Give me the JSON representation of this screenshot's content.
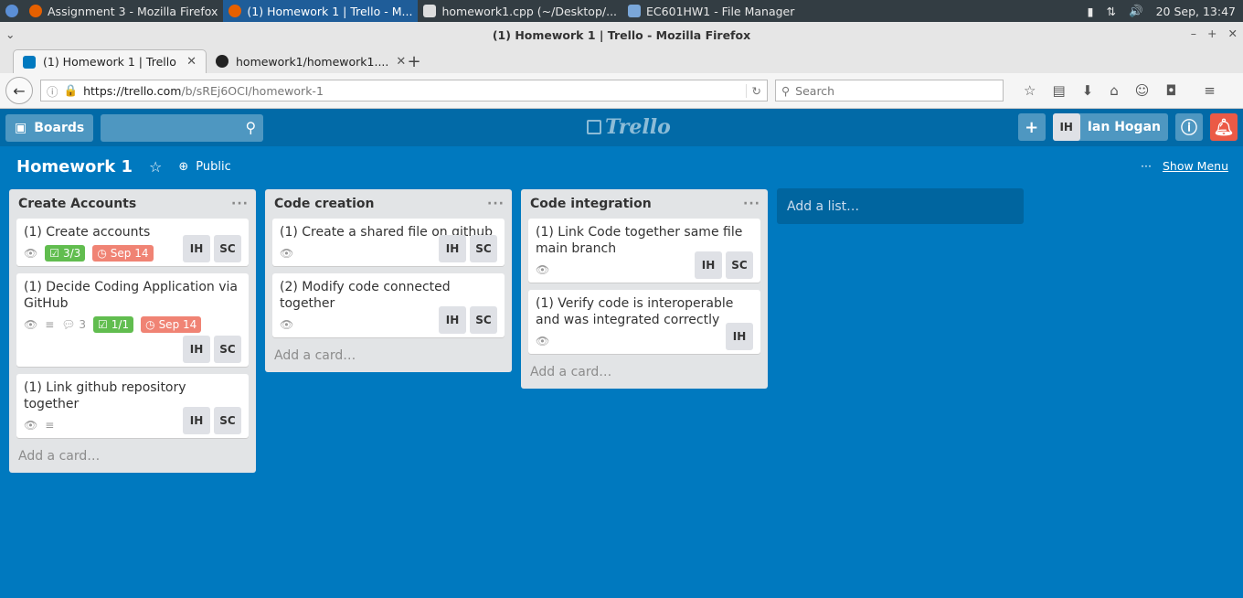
{
  "taskbar": {
    "items": [
      {
        "label": "Assignment 3 - Mozilla Firefox"
      },
      {
        "label": "(1) Homework 1 | Trello - M..."
      },
      {
        "label": "homework1.cpp (~/Desktop/..."
      },
      {
        "label": "EC601HW1 - File Manager"
      }
    ],
    "clock": "20 Sep, 13:47"
  },
  "firefox": {
    "window_title": "(1) Homework 1 | Trello - Mozilla Firefox",
    "tabs": [
      {
        "label": "(1) Homework 1 | Trello"
      },
      {
        "label": "homework1/homework1...."
      }
    ],
    "url_domain": "https://trello.com",
    "url_path": "/b/sREj6OCI/homework-1",
    "search_placeholder": "Search"
  },
  "trello": {
    "boards_label": "Boards",
    "logo": "Trello",
    "user_initials": "IH",
    "user_name": "Ian Hogan",
    "board_title": "Homework 1",
    "visibility": "Public",
    "show_menu": "Show Menu",
    "add_list": "Add a list…",
    "add_card": "Add a card…"
  },
  "lists": [
    {
      "title": "Create Accounts",
      "cards": [
        {
          "title": "(1) Create accounts",
          "checklist": "3/3",
          "due": "Sep 14",
          "members": [
            "IH",
            "SC"
          ]
        },
        {
          "title": "(1) Decide Coding Application via GitHub",
          "comments": "3",
          "checklist": "1/1",
          "due": "Sep 14",
          "members": [
            "IH",
            "SC"
          ]
        },
        {
          "title": "(1) Link github repository together",
          "members": [
            "IH",
            "SC"
          ]
        }
      ]
    },
    {
      "title": "Code creation",
      "cards": [
        {
          "title": "(1) Create a shared file on github",
          "members": [
            "IH",
            "SC"
          ]
        },
        {
          "title": "(2) Modify code connected together",
          "members": [
            "IH",
            "SC"
          ]
        }
      ]
    },
    {
      "title": "Code integration",
      "cards": [
        {
          "title": "(1) Link Code together same file main branch",
          "members": [
            "IH",
            "SC"
          ]
        },
        {
          "title": "(1) Verify code is interoperable and was integrated correctly",
          "members": [
            "IH"
          ]
        }
      ]
    }
  ]
}
